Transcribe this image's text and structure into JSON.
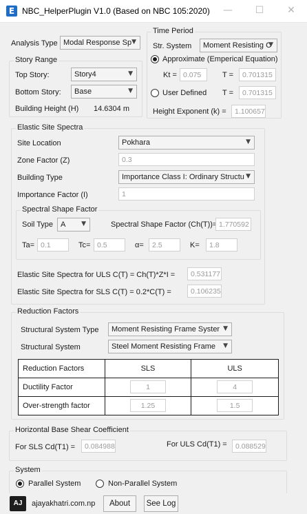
{
  "window": {
    "title": "NBC_HelperPlugin V1.0 (Based on NBC 105:2020)",
    "icon_letter": "E",
    "minimize_glyph": "—",
    "maximize_glyph": "☐",
    "close_glyph": "✕"
  },
  "analysis": {
    "label": "Analysis Type",
    "value": "Modal Response Sp"
  },
  "story_range": {
    "legend": "Story Range",
    "top_label": "Top Story:",
    "top_value": "Story4",
    "bottom_label": "Bottom Story:",
    "bottom_value": "Base",
    "height_label": "Building Height (H)",
    "height_value": "14.6304 m"
  },
  "time_period": {
    "legend": "Time Period",
    "str_label": "Str. System",
    "str_value": "Moment Resisting C",
    "approx_label": "Approximate (Emperical Equation)",
    "kt_label": "Kt =",
    "kt_value": "0.075",
    "t_label": "T =",
    "t_approx_value": "0.701315",
    "user_label": "User Defined",
    "t_user_value": "0.701315",
    "exp_label": "Height Exponent (k) =",
    "exp_value": "1.100657"
  },
  "elastic": {
    "legend": "Elastic Site Spectra",
    "site_label": "Site Location",
    "site_value": "Pokhara",
    "zone_label": "Zone Factor (Z)",
    "zone_value": "0.3",
    "btype_label": "Building Type",
    "btype_value": "Importance Class I: Ordinary Structu",
    "imp_label": "Importance Factor (I)",
    "imp_value": "1",
    "ssf": {
      "legend": "Spectral Shape Factor",
      "soil_label": "Soil Type",
      "soil_value": "A",
      "ch_label": "Spectral Shape Factor (Ch(T))=",
      "ch_value": "1.770592",
      "ta_label": "Ta=",
      "ta_value": "0.1",
      "tc_label": "Tc=",
      "tc_value": "0.5",
      "alpha_label": "α=",
      "alpha_value": "2.5",
      "k_label": "K=",
      "k_value": "1.8"
    },
    "uls_label": "Elastic Site Spectra for ULS C(T) = Ch(T)*Z*I =",
    "uls_value": "0.531177",
    "sls_label": "Elastic Site Spectra for SLS C(T) = 0.2*C(T) =",
    "sls_value": "0.106235"
  },
  "reduction": {
    "legend": "Reduction Factors",
    "sst_label": "Structural System Type",
    "sst_value": "Moment Resisting Frame Syster",
    "ss_label": "Structural System",
    "ss_value": "Steel Moment Resisting Frame",
    "table": {
      "headers": [
        "Reduction Factors",
        "SLS",
        "ULS"
      ],
      "rows": [
        {
          "name": "Ductility Factor",
          "sls": "1",
          "uls": "4"
        },
        {
          "name": "Over-strength factor",
          "sls": "1.25",
          "uls": "1.5"
        }
      ]
    }
  },
  "hbsc": {
    "legend": "Horizontal Base Shear Coefficient",
    "sls_label": "For SLS Cd(T1) =",
    "sls_value": "0.084988",
    "uls_label": "For ULS Cd(T1) =",
    "uls_value": "0.088529"
  },
  "system": {
    "legend": "System",
    "parallel_label": "Parallel System",
    "nonparallel_label": "Non-Parallel System"
  },
  "footer": {
    "logo_text": "AJ",
    "site": "ajayakhatri.com.np",
    "about_label": "About",
    "seelog_label": "See Log"
  }
}
